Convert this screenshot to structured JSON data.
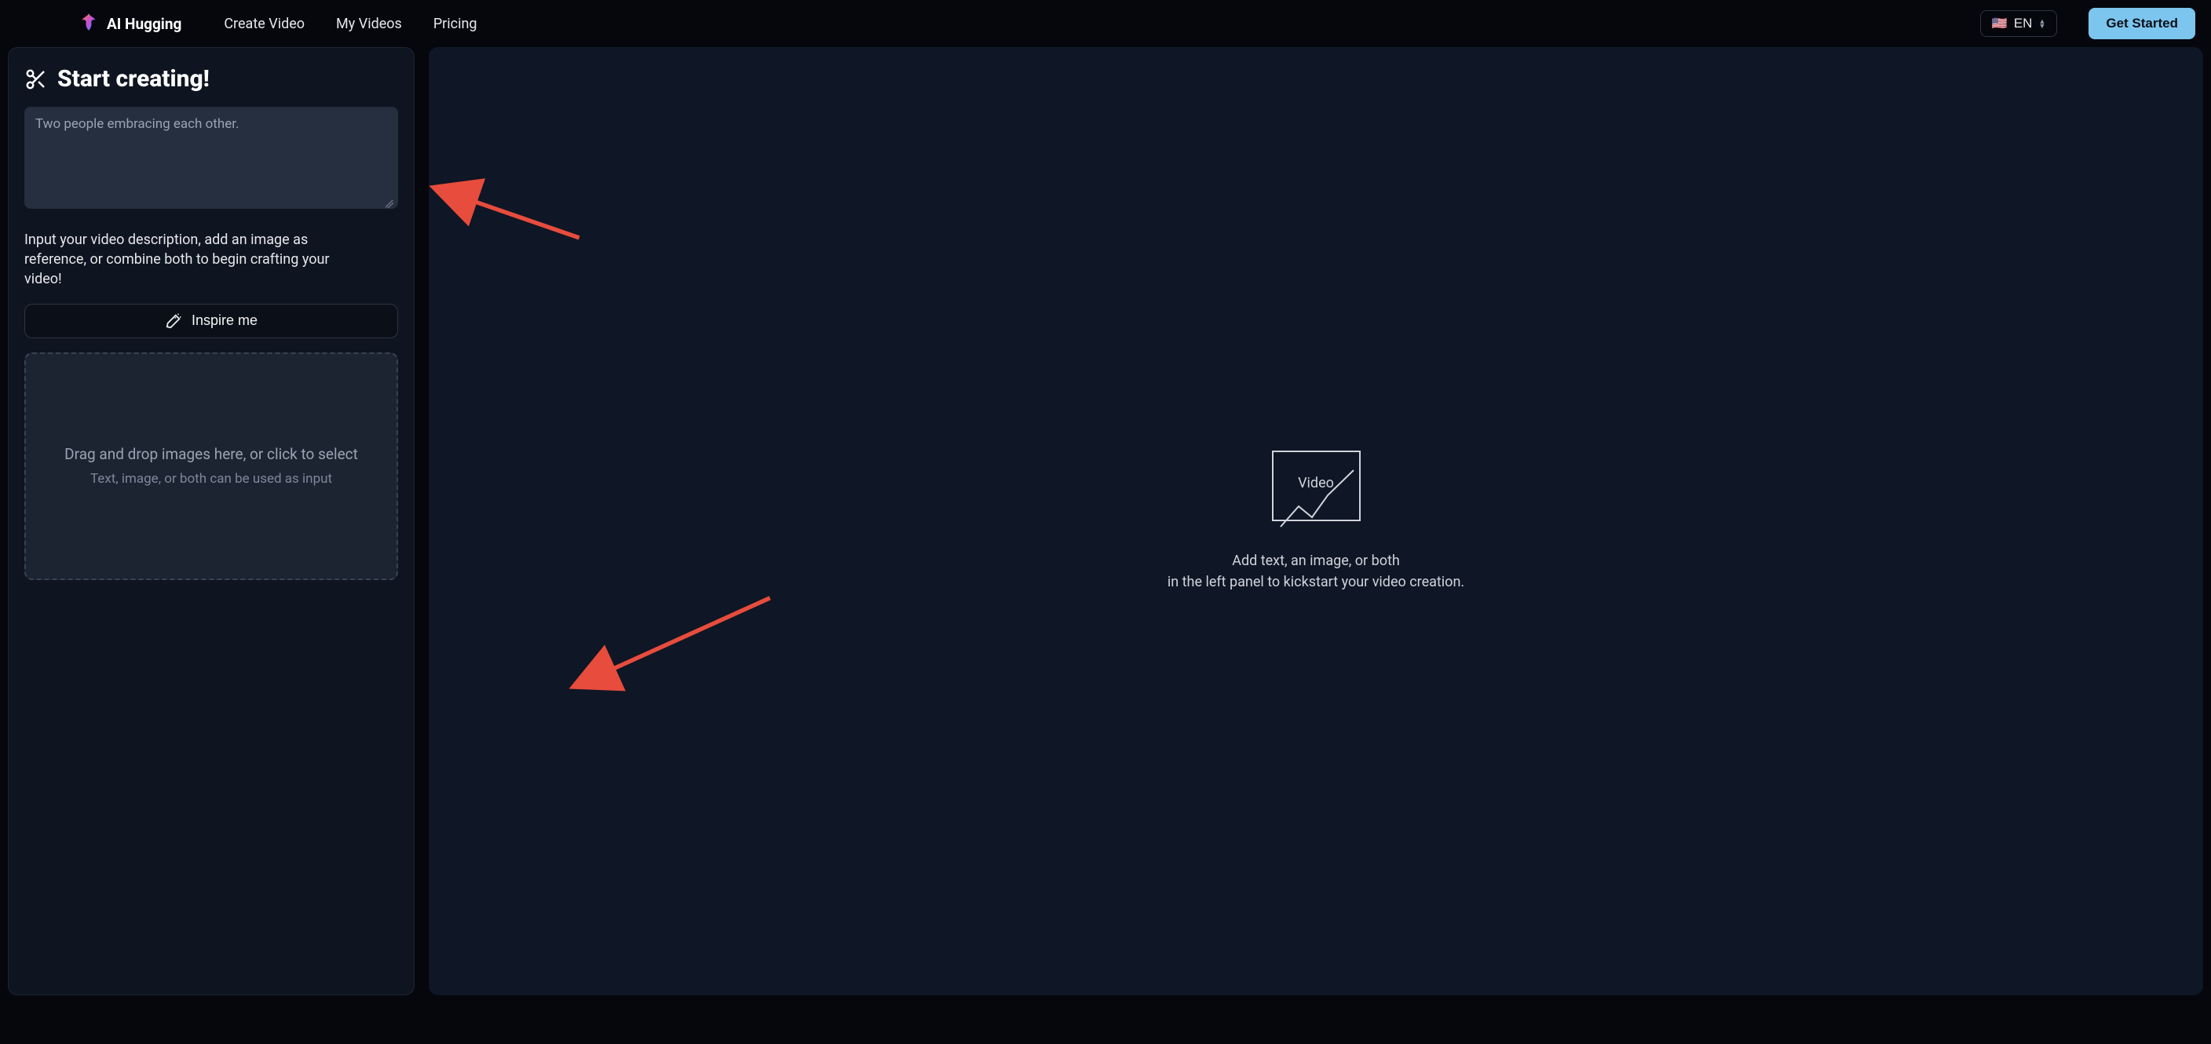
{
  "brand": {
    "name": "AI Hugging"
  },
  "nav": {
    "create": "Create Video",
    "mine": "My Videos",
    "pricing": "Pricing"
  },
  "lang": {
    "flag": "🇺🇸",
    "code": "EN"
  },
  "cta": "Get Started",
  "panel": {
    "title": "Start creating!",
    "prompt_placeholder": "Two people embracing each other.",
    "hint": "Input your video description, add an image as reference, or combine both to begin crafting your video!",
    "inspire": "Inspire me",
    "drop_line1": "Drag and drop images here, or click to select",
    "drop_line2": "Text, image, or both can be used as input"
  },
  "preview": {
    "icon_label": "Video",
    "line1": "Add text, an image, or both",
    "line2": "in the left panel to kickstart your video creation."
  }
}
